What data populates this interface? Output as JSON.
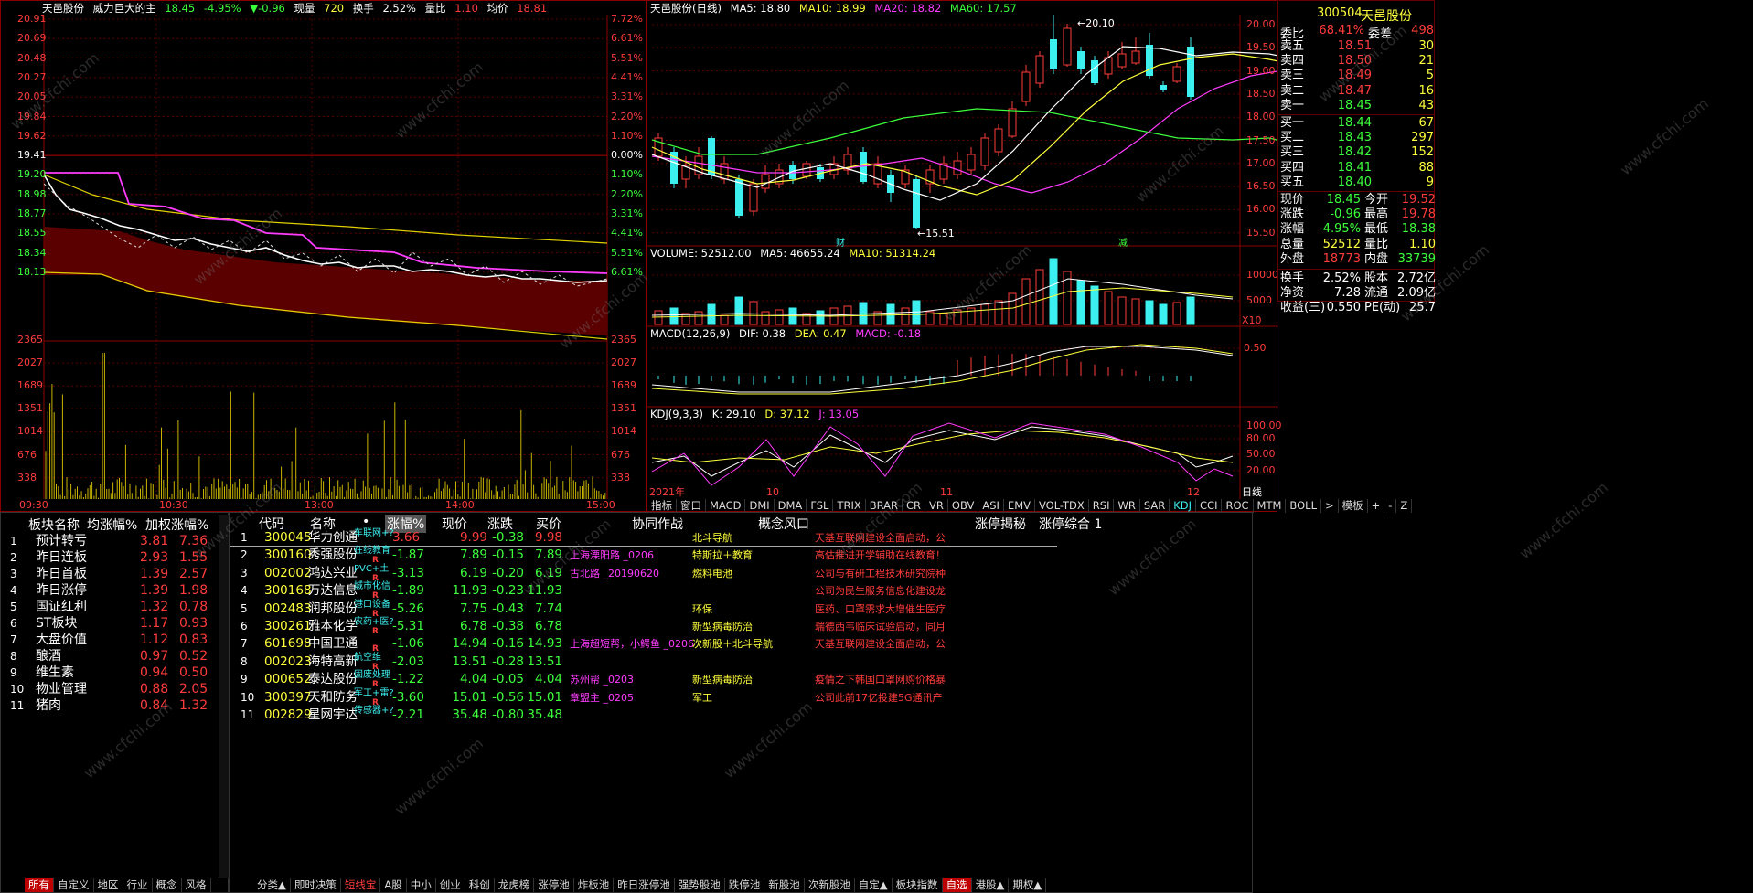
{
  "colors": {
    "up": "#ff3c3c",
    "down": "#3cff3c",
    "flat": "#ffffff",
    "grid": "#8a0000",
    "accent": "#c00000",
    "cyan": "#3cf0f0",
    "yellow": "#ffff3c",
    "magenta": "#ff3cff"
  },
  "intraday": {
    "header": {
      "name": "天邑股份",
      "indicator": "威力巨大的主",
      "price": "18.45",
      "pct": "-4.95%",
      "chg": "▼-0.96",
      "vol_label": "现量",
      "vol": "720",
      "turn_label": "换手",
      "turn": "2.52%",
      "ratio_label": "量比",
      "ratio": "1.10",
      "avg_label": "均价",
      "avg": "18.81"
    },
    "price_ticks": [
      "20.91",
      "20.69",
      "20.48",
      "20.27",
      "20.05",
      "19.84",
      "19.62",
      "19.41",
      "19.20",
      "18.98",
      "18.77",
      "18.55",
      "18.34",
      "18.13"
    ],
    "pct_ticks": [
      "7.72%",
      "6.61%",
      "5.51%",
      "4.41%",
      "3.31%",
      "2.20%",
      "1.10%",
      "0.00%",
      "1.10%",
      "2.20%",
      "3.31%",
      "4.41%",
      "5.51%",
      "6.61%"
    ],
    "vol_ticks": [
      "2365",
      "2027",
      "1689",
      "1351",
      "1014",
      "676",
      "338"
    ],
    "time_ticks": [
      "09:30",
      "10:30",
      "13:00",
      "14:00",
      "15:00"
    ]
  },
  "daily": {
    "header": {
      "name": "天邑股份(日线)",
      "ma5": "MA5: 18.80",
      "ma10": "MA10: 18.99",
      "ma20": "MA20: 18.82",
      "ma60": "MA60: 17.57"
    },
    "price_ticks": [
      "20.00",
      "19.50",
      "19.00",
      "18.50",
      "18.00",
      "17.50",
      "17.00",
      "16.50",
      "16.00",
      "15.50"
    ],
    "high_label": "20.10",
    "low_label": "15.51",
    "cai_label": "财",
    "jian_label": "减",
    "volume_header": {
      "title": "VOLUME: 52512.00",
      "ma5": "MA5: 46655.24",
      "ma10": "MA10: 51314.24"
    },
    "volume_ticks": [
      "10000",
      "5000"
    ],
    "volume_unit": "X10",
    "macd_header": {
      "title": "MACD(12,26,9)",
      "dif": "DIF: 0.38",
      "dea": "DEA: 0.47",
      "macd": "MACD: -0.18"
    },
    "macd_tick": "0.50",
    "kdj_header": {
      "title": "KDJ(9,3,3)",
      "k": "K: 29.10",
      "d": "D: 37.12",
      "j": "J: 13.05"
    },
    "kdj_ticks": [
      "100.00",
      "80.00",
      "50.00",
      "20.00"
    ],
    "date_ticks": [
      "2021年",
      "10",
      "11",
      "12"
    ],
    "period": "日线",
    "indicator_tabs": [
      "指标",
      "窗口",
      "MACD",
      "DMI",
      "DMA",
      "FSL",
      "TRIX",
      "BRAR",
      "CR",
      "VR",
      "OBV",
      "ASI",
      "EMV",
      "VOL-TDX",
      "RSI",
      "WR",
      "SAR",
      "KDJ",
      "CCI",
      "ROC",
      "MTM",
      "BOLL",
      ">",
      "模板",
      "+",
      "-",
      "Z"
    ]
  },
  "quote": {
    "code": "300504",
    "name": "天邑股份",
    "wb_label": "委比",
    "wb": "68.41%",
    "wc_label": "委差",
    "wc": "498",
    "asks": [
      {
        "l": "卖五",
        "p": "18.51",
        "v": "30"
      },
      {
        "l": "卖四",
        "p": "18.50",
        "v": "21"
      },
      {
        "l": "卖三",
        "p": "18.49",
        "v": "5"
      },
      {
        "l": "卖二",
        "p": "18.47",
        "v": "16"
      },
      {
        "l": "卖一",
        "p": "18.45",
        "v": "43"
      }
    ],
    "bids": [
      {
        "l": "买一",
        "p": "18.44",
        "v": "67"
      },
      {
        "l": "买二",
        "p": "18.43",
        "v": "297"
      },
      {
        "l": "买三",
        "p": "18.42",
        "v": "152"
      },
      {
        "l": "买四",
        "p": "18.41",
        "v": "88"
      },
      {
        "l": "买五",
        "p": "18.40",
        "v": "9"
      }
    ],
    "stats": [
      {
        "l1": "现价",
        "v1": "18.45",
        "c1": "green",
        "l2": "今开",
        "v2": "19.52",
        "c2": "red"
      },
      {
        "l1": "涨跌",
        "v1": "-0.96",
        "c1": "green",
        "l2": "最高",
        "v2": "19.78",
        "c2": "red"
      },
      {
        "l1": "涨幅",
        "v1": "-4.95%",
        "c1": "green",
        "l2": "最低",
        "v2": "18.38",
        "c2": "green"
      },
      {
        "l1": "总量",
        "v1": "52512",
        "c1": "yellow",
        "l2": "量比",
        "v2": "1.10",
        "c2": "yellow"
      },
      {
        "l1": "外盘",
        "v1": "18773",
        "c1": "red",
        "l2": "内盘",
        "v2": "33739",
        "c2": "green"
      },
      {
        "l1": "换手",
        "v1": "2.52%",
        "c1": "white",
        "l2": "股本",
        "v2": "2.72亿",
        "c2": "white"
      },
      {
        "l1": "净资",
        "v1": "7.28",
        "c1": "white",
        "l2": "流通",
        "v2": "2.09亿",
        "c2": "white"
      },
      {
        "l1": "收益(三)",
        "v1": "0.550",
        "c1": "white",
        "l2": "PE(动)",
        "v2": "25.7",
        "c2": "white"
      }
    ]
  },
  "sector": {
    "headers": [
      "板块名称",
      "均涨幅%",
      "加权涨幅%"
    ],
    "rows": [
      {
        "n": "1",
        "name": "预计转亏",
        "a": "3.81",
        "b": "7.36"
      },
      {
        "n": "2",
        "name": "昨日连板",
        "a": "2.93",
        "b": "1.55"
      },
      {
        "n": "3",
        "name": "昨日首板",
        "a": "1.39",
        "b": "2.57"
      },
      {
        "n": "4",
        "name": "昨日涨停",
        "a": "1.39",
        "b": "1.98"
      },
      {
        "n": "5",
        "name": "国证红利",
        "a": "1.32",
        "b": "0.78"
      },
      {
        "n": "6",
        "name": "ST板块",
        "a": "1.17",
        "b": "0.93"
      },
      {
        "n": "7",
        "name": "大盘价值",
        "a": "1.12",
        "b": "0.83"
      },
      {
        "n": "8",
        "name": "酿酒",
        "a": "0.97",
        "b": "0.52"
      },
      {
        "n": "9",
        "name": "维生素",
        "a": "0.94",
        "b": "0.50"
      },
      {
        "n": "10",
        "name": "物业管理",
        "a": "0.88",
        "b": "2.05"
      },
      {
        "n": "11",
        "name": "猪肉",
        "a": "0.84",
        "b": "1.32"
      }
    ],
    "tabs": [
      "所有",
      "自定义",
      "地区",
      "行业",
      "概念",
      "风格"
    ]
  },
  "stocks": {
    "headers": [
      "代码",
      "名称",
      "•",
      "涨幅%",
      "现价",
      "涨跌",
      "买价",
      "协同作战",
      "概念风口",
      "涨停揭秘",
      "涨停综合 1"
    ],
    "rows": [
      {
        "n": "1",
        "code": "300045",
        "name": "华力创通",
        "tag": "车联网+?",
        "r": "",
        "pct": "3.66",
        "price": "9.99",
        "chg": "-0.38",
        "bid": "9.98",
        "xt": "",
        "gn": "北斗导航",
        "zt": "天基互联网建设全面启动，公"
      },
      {
        "n": "2",
        "code": "300160",
        "name": "秀强股份",
        "tag": "在线教育",
        "r": "R",
        "pct": "-1.87",
        "price": "7.89",
        "chg": "-0.15",
        "bid": "7.89",
        "xt": "上海溧阳路 _0206",
        "gn": "特斯拉＋教育",
        "zt": "高估推进开学辅助在线教育！"
      },
      {
        "n": "3",
        "code": "002002",
        "name": "鸿达兴业",
        "tag": "PVC+土",
        "r": "R",
        "pct": "-3.13",
        "price": "6.19",
        "chg": "-0.20",
        "bid": "6.19",
        "xt": "古北路 _20190620",
        "gn": "燃料电池",
        "zt": "公司与有研工程技术研究院种"
      },
      {
        "n": "4",
        "code": "300168",
        "name": "万达信息",
        "tag": "城市化信",
        "r": "R",
        "pct": "-1.89",
        "price": "11.93",
        "chg": "-0.23",
        "bid": "11.93",
        "xt": "",
        "gn": "",
        "zt": "公司为民生服务信息化建设龙"
      },
      {
        "n": "5",
        "code": "002483",
        "name": "润邦股份",
        "tag": "港口设备",
        "r": "R",
        "pct": "-5.26",
        "price": "7.75",
        "chg": "-0.43",
        "bid": "7.74",
        "xt": "",
        "gn": "环保",
        "zt": "医药、口罩需求大增催生医疗"
      },
      {
        "n": "6",
        "code": "300261",
        "name": "雅本化学",
        "tag": "农药+医?",
        "r": "R",
        "pct": "-5.31",
        "price": "6.78",
        "chg": "-0.38",
        "bid": "6.78",
        "xt": "",
        "gn": "新型病毒防治",
        "zt": "瑞德西韦临床试验启动，同月"
      },
      {
        "n": "7",
        "code": "601698",
        "name": "中国卫通",
        "tag": "",
        "r": "R",
        "pct": "-1.06",
        "price": "14.94",
        "chg": "-0.16",
        "bid": "14.93",
        "xt": "上海超短帮，小鳄鱼 _0206",
        "gn": "次新股＋北斗导航",
        "zt": "天基互联网建设全面启动，公"
      },
      {
        "n": "8",
        "code": "002023",
        "name": "海特高新",
        "tag": "航空维",
        "r": "R",
        "pct": "-2.03",
        "price": "13.51",
        "chg": "-0.28",
        "bid": "13.51",
        "xt": "",
        "gn": "",
        "zt": ""
      },
      {
        "n": "9",
        "code": "000652",
        "name": "泰达股份",
        "tag": "固废处理",
        "r": "R",
        "pct": "-1.22",
        "price": "4.04",
        "chg": "-0.05",
        "bid": "4.04",
        "xt": "苏州帮 _0203",
        "gn": "新型病毒防治",
        "zt": "疫情之下韩国口罩网购价格暴"
      },
      {
        "n": "10",
        "code": "300397",
        "name": "天和防务",
        "tag": "军工+雷?",
        "r": "R",
        "pct": "-3.60",
        "price": "15.01",
        "chg": "-0.56",
        "bid": "15.01",
        "xt": "章盟主 _0205",
        "gn": "军工",
        "zt": "公司此前17亿投建5G通讯产"
      },
      {
        "n": "11",
        "code": "002829",
        "name": "星网宇达",
        "tag": "传感器+?",
        "r": "",
        "pct": "-2.21",
        "price": "35.48",
        "chg": "-0.80",
        "bid": "35.48",
        "xt": "",
        "gn": "",
        "zt": ""
      }
    ],
    "tabs": [
      "分类▲",
      "即时决策",
      "短线宝",
      "A股",
      "中小",
      "创业",
      "科创",
      "龙虎榜",
      "涨停池",
      "炸板池",
      "昨日涨停池",
      "强势股池",
      "跌停池",
      "新股池",
      "次新股池",
      "自定▲",
      "板块指数",
      "自选",
      "港股▲",
      "期权▲"
    ]
  },
  "watermark": "www.cfchi.com"
}
